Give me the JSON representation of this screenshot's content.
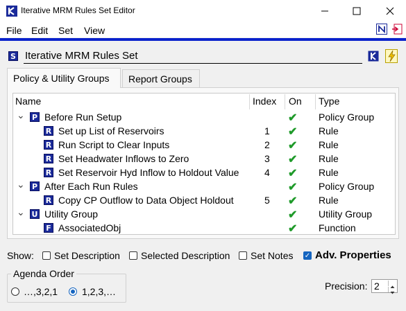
{
  "window": {
    "title": "Iterative MRM Rules Set Editor"
  },
  "menu": [
    "File",
    "Edit",
    "Set",
    "View"
  ],
  "set": {
    "badge": "S",
    "name": "Iterative MRM Rules Set"
  },
  "tabs": [
    "Policy & Utility Groups",
    "Report Groups"
  ],
  "table": {
    "columns": [
      "Name",
      "Index",
      "On",
      "Type"
    ],
    "rows": [
      {
        "level": 0,
        "badge": "P",
        "name": "Before Run Setup",
        "index": "",
        "on": "✔",
        "type": "Policy Group"
      },
      {
        "level": 1,
        "badge": "R",
        "name": "Set up List of Reservoirs",
        "index": "1",
        "on": "✔",
        "type": "Rule"
      },
      {
        "level": 1,
        "badge": "R",
        "name": "Run Script to Clear Inputs",
        "index": "2",
        "on": "✔",
        "type": "Rule"
      },
      {
        "level": 1,
        "badge": "R",
        "name": "Set Headwater Inflows to Zero",
        "index": "3",
        "on": "✔",
        "type": "Rule"
      },
      {
        "level": 1,
        "badge": "R",
        "name": "Set Reservoir Hyd Inflow to Holdout Value",
        "index": "4",
        "on": "✔",
        "type": "Rule"
      },
      {
        "level": 0,
        "badge": "P",
        "name": "After Each Run Rules",
        "index": "",
        "on": "✔",
        "type": "Policy Group"
      },
      {
        "level": 1,
        "badge": "R",
        "name": "Copy CP Outflow to Data Object Holdout",
        "index": "5",
        "on": "✔",
        "type": "Rule"
      },
      {
        "level": 0,
        "badge": "U",
        "name": "Utility Group",
        "index": "",
        "on": "✔",
        "type": "Utility Group"
      },
      {
        "level": 1,
        "badge": "F",
        "name": "AssociatedObj",
        "index": "",
        "on": "✔",
        "type": "Function"
      }
    ]
  },
  "show": {
    "label": "Show:",
    "options": [
      {
        "label": "Set Description",
        "checked": false
      },
      {
        "label": "Selected Description",
        "checked": false
      },
      {
        "label": "Set Notes",
        "checked": false
      },
      {
        "label": "Adv. Properties",
        "checked": true
      }
    ]
  },
  "agenda": {
    "legend": "Agenda Order",
    "options": [
      {
        "label": "…,3,2,1",
        "selected": false
      },
      {
        "label": "1,2,3,…",
        "selected": true
      }
    ]
  },
  "precision": {
    "label": "Precision:",
    "value": "2"
  },
  "colors": {
    "accent": "#0a22cc",
    "badge": "#1a2a9a",
    "check": "#1f9a2a",
    "selected": "#1565c0"
  }
}
